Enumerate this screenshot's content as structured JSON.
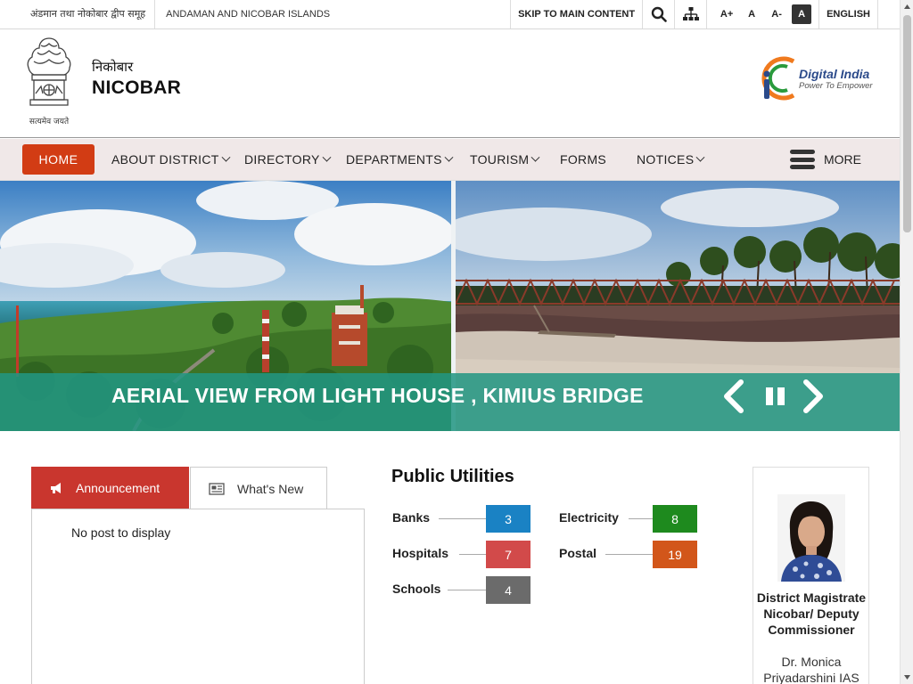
{
  "topbar": {
    "hindi_label": "अंडमान तथा नोकोबार द्वीप समूह",
    "english_label": "ANDAMAN AND NICOBAR ISLANDS",
    "skip_label": "SKIP TO MAIN CONTENT",
    "font_increase": "A+",
    "font_normal": "A",
    "font_decrease": "A-",
    "contrast": "A",
    "language": "ENGLISH",
    "icons": [
      "search-icon",
      "sitemap-icon"
    ]
  },
  "header": {
    "emblem_caption": "सत्यमेव जयते",
    "site_hindi": "निकोबार",
    "site_name": "NICOBAR",
    "di_title": "Digital India",
    "di_subtitle": "Power To Empower"
  },
  "nav": {
    "home": "HOME",
    "items": [
      {
        "label": "ABOUT DISTRICT",
        "dropdown": true
      },
      {
        "label": "DIRECTORY",
        "dropdown": true
      },
      {
        "label": "DEPARTMENTS",
        "dropdown": true
      },
      {
        "label": "TOURISM",
        "dropdown": true
      },
      {
        "label": "FORMS",
        "dropdown": false
      },
      {
        "label": "NOTICES",
        "dropdown": true
      }
    ],
    "more": "MORE"
  },
  "slider": {
    "caption": "AERIAL VIEW FROM LIGHT HOUSE , KIMIUS BRIDGE",
    "accent": "#229682"
  },
  "tabs": {
    "announcement": "Announcement",
    "whats_new": "What's New",
    "empty_message": "No post to display"
  },
  "utilities": {
    "title": "Public Utilities",
    "items": [
      {
        "label": "Banks",
        "count": "3",
        "color": "#1a82c4"
      },
      {
        "label": "Electricity",
        "count": "8",
        "color": "#1e8a1e"
      },
      {
        "label": "Hospitals",
        "count": "7",
        "color": "#d24a4a"
      },
      {
        "label": "Postal",
        "count": "19",
        "color": "#d2561a"
      },
      {
        "label": "Schools",
        "count": "4",
        "color": "#6b6b6b"
      }
    ]
  },
  "officer": {
    "title": "District Magistrate Nicobar/ Deputy Commissioner",
    "name": "Dr. Monica Priyadarshini IAS"
  },
  "colors": {
    "brand_red": "#d23c14",
    "nav_bg": "#f0e8e8",
    "tab_red": "#c9362e"
  }
}
